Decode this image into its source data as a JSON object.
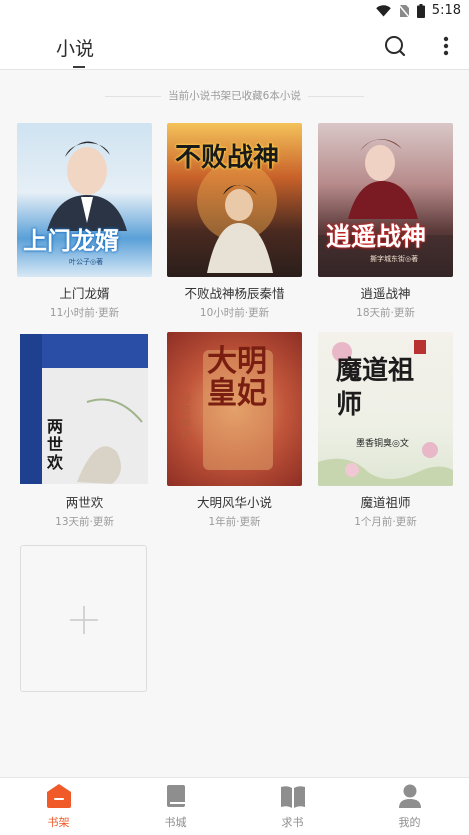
{
  "status_bar": {
    "time": "5:18"
  },
  "app_bar": {
    "title": "小说"
  },
  "shelf": {
    "notice": "当前小说书架已收藏6本小说",
    "books": [
      {
        "title": "上门龙婿",
        "updated": "11小时前·更新",
        "cover_text": "上门龙婿",
        "cover_author": "叶公子◎著"
      },
      {
        "title": "不败战神杨辰秦惜",
        "updated": "10小时前·更新",
        "cover_text": "不败战神"
      },
      {
        "title": "逍遥战神",
        "updated": "18天前·更新",
        "cover_text": "逍遥战神",
        "cover_author": "撕字城东街◎著"
      },
      {
        "title": "两世欢",
        "updated": "13天前·更新",
        "cover_text": "两世欢"
      },
      {
        "title": "大明风华小说",
        "updated": "1年前·更新",
        "cover_text": "大明皇妃",
        "cover_author": "孙若微传"
      },
      {
        "title": "魔道祖师",
        "updated": "1个月前·更新",
        "cover_text": "魔道祖师",
        "cover_author": "墨香铜臭◎文"
      }
    ]
  },
  "tabs": [
    {
      "label": "书架",
      "icon": "bookshelf-icon",
      "active": true
    },
    {
      "label": "书城",
      "icon": "book-icon",
      "active": false
    },
    {
      "label": "求书",
      "icon": "open-book-icon",
      "active": false
    },
    {
      "label": "我的",
      "icon": "person-icon",
      "active": false
    }
  ],
  "colors": {
    "accent": "#f05a28",
    "title_underline": "#3c3c3c",
    "background": "#f7f7f7"
  }
}
